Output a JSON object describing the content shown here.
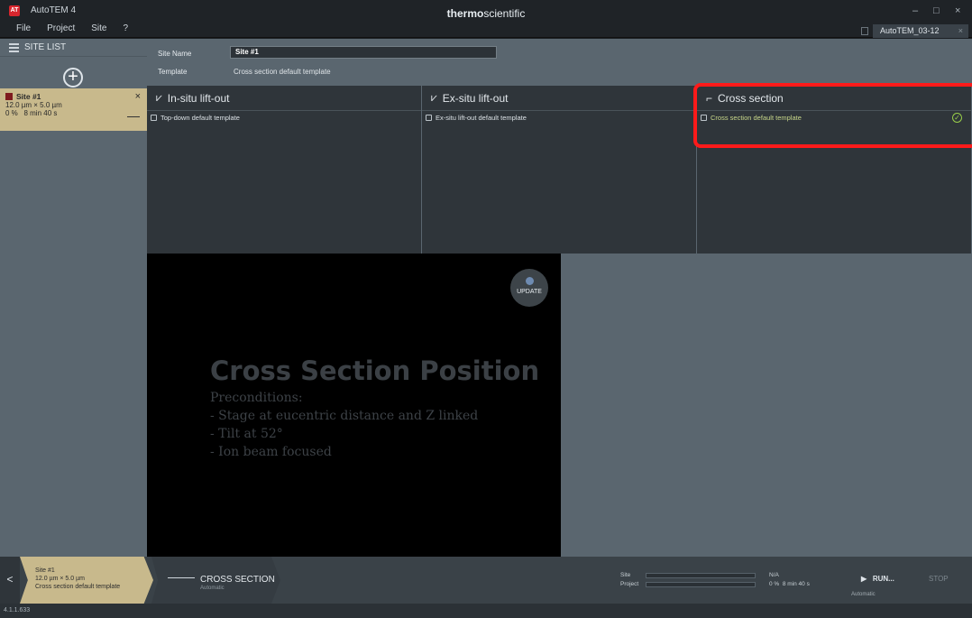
{
  "app": {
    "title": "AutoTEM 4",
    "logo": "AT",
    "brand_bold": "thermo",
    "brand_rest": "scientific",
    "menu": [
      "File",
      "Project",
      "Site",
      "?"
    ]
  },
  "window": {
    "minimize": "–",
    "maximize": "□",
    "close": "×"
  },
  "doc_tab": {
    "label": "AutoTEM_03-12",
    "close": "×"
  },
  "sidebar": {
    "title": "SITE LIST",
    "add": "+",
    "site": {
      "name": "Site #1",
      "size": "12.0 µm × 5.0 µm",
      "progress": "0 %",
      "time": "8 min 40 s",
      "close": "×"
    }
  },
  "site_info": {
    "site_name_label": "Site Name",
    "site_name_value": "Site #1",
    "template_label": "Template",
    "template_value": "Cross section default template"
  },
  "workflows": [
    {
      "title": "In-situ lift-out",
      "template": "Top-down default template"
    },
    {
      "title": "Ex-situ lift-out",
      "template": "Ex-situ lift-out default template"
    },
    {
      "title": "Cross section",
      "template": "Cross section default template"
    }
  ],
  "viewer": {
    "update": "UPDATE",
    "heading": "Cross Section Position",
    "pre_title": "Preconditions:",
    "pre_1": "- Stage at eucentric distance and Z linked",
    "pre_2": "- Tilt at 52°",
    "pre_3": "- Ion beam focused"
  },
  "bottom": {
    "back": "<",
    "site_name": "Site #1",
    "site_size": "12.0 µm × 5.0 µm",
    "site_template": "Cross section default template",
    "step_label": "CROSS SECTION",
    "step_sub": "Automatic",
    "site_label": "Site",
    "project_label": "Project",
    "site_value": "N/A",
    "project_percent": "0 %",
    "project_time": "8 min 40 s",
    "run": "RUN...",
    "run_sub": "Automatic",
    "stop": "STOP"
  },
  "status": {
    "version": "4.1.1.633"
  },
  "colors": {
    "highlight": "#ff1a1a",
    "site_card": "#c8b98c",
    "ok_check": "#9ad04a"
  }
}
